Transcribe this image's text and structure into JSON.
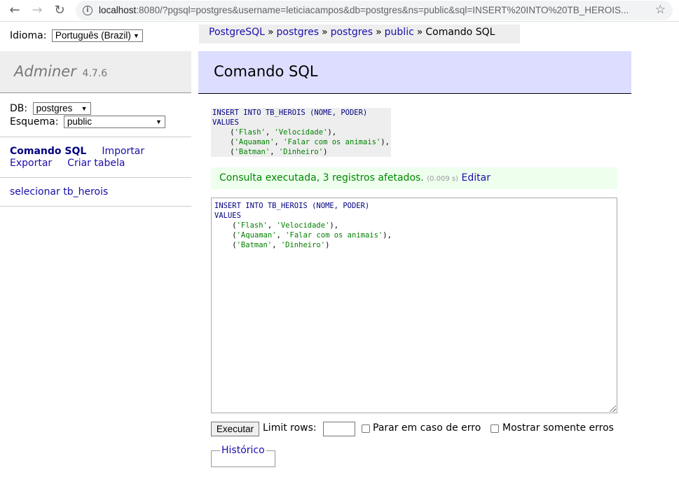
{
  "browser": {
    "url_host": "localhost",
    "url_rest": ":8080/?pgsql=postgres&username=leticiacampos&db=postgres&ns=public&sql=INSERT%20INTO%20TB_HEROIS..."
  },
  "sidebar": {
    "language_label": "Idioma:",
    "language_value": "Português (Brazil)",
    "logo": "Adminer",
    "version": "4.7.6",
    "db_label": "DB:",
    "db_value": "postgres",
    "schema_label": "Esquema:",
    "schema_value": "public",
    "links": [
      "Comando SQL",
      "Importar",
      "Exportar",
      "Criar tabela"
    ],
    "tables": [
      "selecionar tb_herois"
    ]
  },
  "breadcrumb": {
    "items": [
      "PostgreSQL",
      "postgres",
      "postgres",
      "public"
    ],
    "current": "Comando SQL",
    "separator": "»"
  },
  "page": {
    "title": "Comando SQL"
  },
  "query": {
    "line1": "INSERT INTO TB_HEROIS (NOME, PODER)",
    "line2": "VALUES",
    "rows": [
      [
        "'Flash'",
        "'Velocidade'",
        "),"
      ],
      [
        "'Aquaman'",
        "'Falar com os animais'",
        "),"
      ],
      [
        "'Batman'",
        "'Dinheiro'",
        ")"
      ]
    ]
  },
  "message": {
    "text": "Consulta executada, 3 registros afetados.",
    "time": "(0.009 s)",
    "edit_link": "Editar"
  },
  "controls": {
    "execute": "Executar",
    "limit_label": "Limit rows:",
    "limit_value": "",
    "stop_on_error": "Parar em caso de erro",
    "only_errors": "Mostrar somente erros",
    "history": "Histórico"
  }
}
